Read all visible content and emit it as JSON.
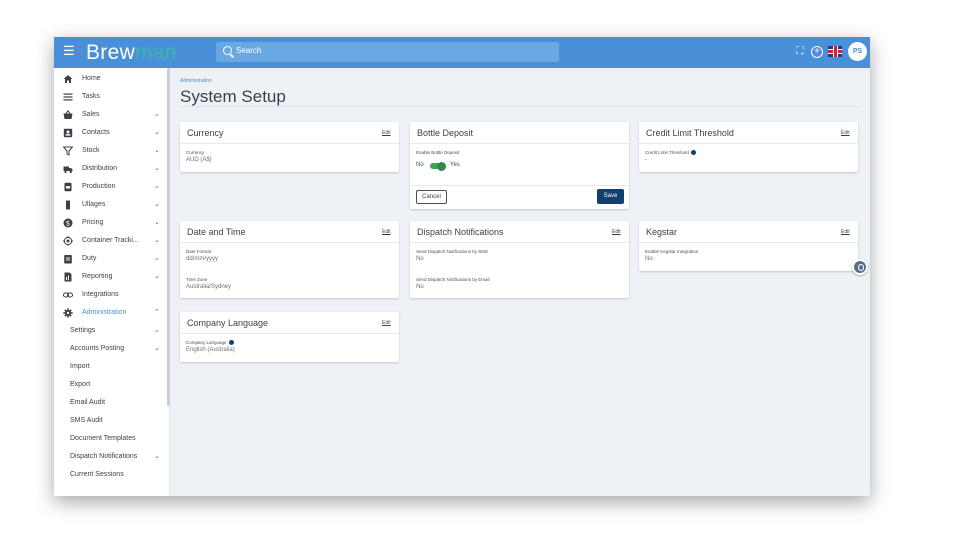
{
  "topbar": {
    "logo_main": "Brew",
    "logo_accent": "man",
    "search_placeholder": "Search",
    "avatar_initials": "PS"
  },
  "sidebar": {
    "items": [
      {
        "label": "Home",
        "icon": "home-icon"
      },
      {
        "label": "Tasks",
        "icon": "list-icon"
      },
      {
        "label": "Sales",
        "icon": "basket-icon",
        "chevron": "⌄"
      },
      {
        "label": "Contacts",
        "icon": "contacts-icon",
        "chevron": "⌄"
      },
      {
        "label": "Stock",
        "icon": "filter-icon",
        "chevron": "⌄"
      },
      {
        "label": "Distribution",
        "icon": "truck-icon",
        "chevron": "⌄"
      },
      {
        "label": "Production",
        "icon": "production-icon",
        "chevron": "⌄"
      },
      {
        "label": "Ullages",
        "icon": "bottle-icon",
        "chevron": "⌄"
      },
      {
        "label": "Pricing",
        "icon": "dollar-icon",
        "chevron": "⌄"
      },
      {
        "label": "Container Tracki...",
        "icon": "target-icon",
        "chevron": "⌄"
      },
      {
        "label": "Duty",
        "icon": "clipboard-icon",
        "chevron": "⌄"
      },
      {
        "label": "Reporting",
        "icon": "report-icon",
        "chevron": "⌄"
      },
      {
        "label": "Integrations",
        "icon": "link-icon"
      },
      {
        "label": "Administration",
        "icon": "gear-icon",
        "chevron": "⌃"
      }
    ],
    "sub_items": [
      {
        "label": "Settings",
        "chevron": "⌄"
      },
      {
        "label": "Accounts Posting",
        "chevron": "⌄"
      },
      {
        "label": "Import"
      },
      {
        "label": "Export"
      },
      {
        "label": "Email Audit"
      },
      {
        "label": "SMS Audit"
      },
      {
        "label": "Document Templates"
      },
      {
        "label": "Dispatch Notifications",
        "chevron": "⌄"
      },
      {
        "label": "Current Sessions"
      }
    ]
  },
  "main": {
    "breadcrumb": "Administration",
    "title": "System Setup",
    "edit_label": "Edit",
    "cards": {
      "currency": {
        "title": "Currency",
        "field_label": "Currency",
        "field_value": "AUD (A$)"
      },
      "bottle_deposit": {
        "title": "Bottle Deposit",
        "field_label": "Enable Bottle Deposit",
        "toggle_off": "No",
        "toggle_on": "Yes",
        "toggle_state": "on",
        "cancel_label": "Cancel",
        "save_label": "Save"
      },
      "credit_limit": {
        "title": "Credit Limit Threshold",
        "field_label": "Credit Limit Threshold",
        "field_value": "-"
      },
      "date_time": {
        "title": "Date and Time",
        "format_label": "Date Format",
        "format_value": "dd/mm/yyyy",
        "tz_label": "Time Zone",
        "tz_value": "Australia/Sydney"
      },
      "dispatch": {
        "title": "Dispatch Notifications",
        "sms_label": "Send Dispatch Notifications by SMS",
        "sms_value": "No",
        "email_label": "Send Dispatch Notifications by Email",
        "email_value": "No"
      },
      "kegstar": {
        "title": "Kegstar",
        "field_label": "Enable Kegstar Integration",
        "field_value": "No"
      },
      "company_language": {
        "title": "Company Language",
        "field_label": "Company Language",
        "field_value": "English (Australia)"
      }
    }
  },
  "colors": {
    "topbar": "#4a90d9",
    "accent": "#3fb4ad",
    "primary_button": "#123f6e",
    "toggle": "#34a853"
  }
}
